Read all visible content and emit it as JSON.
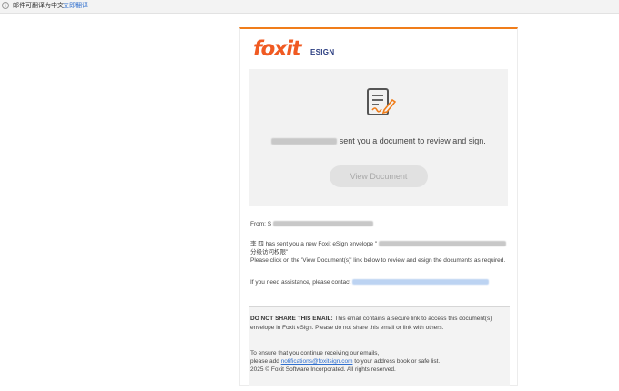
{
  "topbar": {
    "notice": "邮件可翻译为中文",
    "translate_link": "立即翻译"
  },
  "brand": {
    "logo_text": "foxit",
    "product": "ESIGN",
    "accent": "#f07d1a",
    "logo_color": "#f05a22"
  },
  "hero": {
    "sent_text": "sent you a document to review and sign.",
    "button_label": "View Document"
  },
  "details": {
    "from_label": "From: S",
    "sender_line": "李 四 has sent you a new Foxit eSign envelope \"",
    "envelope_name_suffix": "分级访问权限\"",
    "instructions": "Please click on the 'View Document(s)' link below to review and esign the documents as required.",
    "assistance": "If you need assistance, please contact"
  },
  "footer": {
    "warning_title": "DO NOT SHARE THIS EMAIL:",
    "warning_body": "This email contains a secure link to access this document(s) envelope in Foxit eSign. Please do not share this email or link with others.",
    "receiving_line": "To ensure that you continue receiving our emails,",
    "add_prefix": "please add",
    "notifications_email": "notifications@foxitsign.com",
    "add_suffix": "to your address book or safe list.",
    "copyright": "2025 © Foxit Software Incorporated. All rights reserved."
  }
}
